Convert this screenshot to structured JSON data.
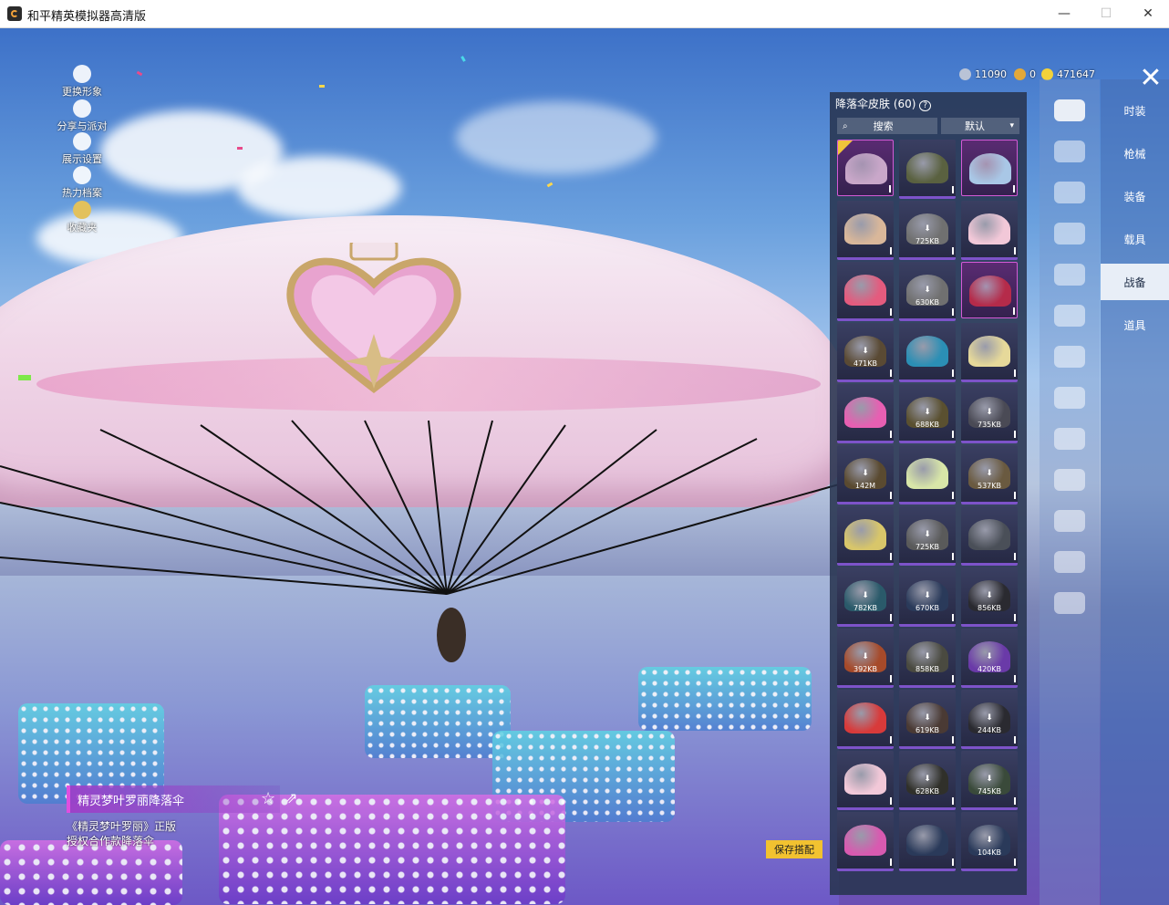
{
  "window": {
    "title": "和平精英模拟器高清版",
    "minimize": "—",
    "maximize": "☐",
    "close": "✕"
  },
  "left_menu": [
    {
      "label": "更换形象",
      "icon": "avatar-icon"
    },
    {
      "label": "分享与派对",
      "icon": "share-icon"
    },
    {
      "label": "展示设置",
      "icon": "eye-icon"
    },
    {
      "label": "热力档案",
      "icon": "fire-icon"
    },
    {
      "label": "收藏夹",
      "icon": "badge-icon"
    }
  ],
  "currency": {
    "a": "11090",
    "b": "0",
    "c": "471647"
  },
  "panel": {
    "title": "降落伞皮肤 (60)",
    "help": "?",
    "search_label": "搜索",
    "sort_label": "默认",
    "items": [
      {
        "color": "#c9a7c9",
        "size": "",
        "selected": true,
        "pink": true
      },
      {
        "color": "#5a6140",
        "size": "",
        "selected": false,
        "pink": false
      },
      {
        "color": "#a9c7e6",
        "size": "",
        "selected": false,
        "pink": true
      },
      {
        "color": "#d9b79a",
        "size": "",
        "selected": false,
        "pink": false
      },
      {
        "color": "#707070",
        "size": "725KB",
        "selected": false,
        "pink": false
      },
      {
        "color": "#f2c8d8",
        "size": "",
        "selected": false,
        "pink": false
      },
      {
        "color": "#e45b7e",
        "size": "",
        "selected": false,
        "pink": false
      },
      {
        "color": "#707070",
        "size": "630KB",
        "selected": false,
        "pink": false
      },
      {
        "color": "#b52b4a",
        "size": "",
        "selected": false,
        "pink": true
      },
      {
        "color": "#5a4a34",
        "size": "471KB",
        "selected": false,
        "pink": false
      },
      {
        "color": "#2b8fb5",
        "size": "",
        "selected": false,
        "pink": false
      },
      {
        "color": "#e6d99a",
        "size": "",
        "selected": false,
        "pink": false
      },
      {
        "color": "#e75fb2",
        "size": "",
        "selected": false,
        "pink": false
      },
      {
        "color": "#5a5030",
        "size": "688KB",
        "selected": false,
        "pink": false
      },
      {
        "color": "#4a4a55",
        "size": "735KB",
        "selected": false,
        "pink": false
      },
      {
        "color": "#5a4a30",
        "size": "142M",
        "selected": false,
        "pink": false
      },
      {
        "color": "#d8e6a8",
        "size": "",
        "selected": false,
        "pink": false
      },
      {
        "color": "#6a5a40",
        "size": "537KB",
        "selected": false,
        "pink": false
      },
      {
        "color": "#d8c66a",
        "size": "",
        "selected": false,
        "pink": false
      },
      {
        "color": "#5a5a5a",
        "size": "725KB",
        "selected": false,
        "pink": false
      },
      {
        "color": "#4a4f58",
        "size": "",
        "selected": false,
        "pink": false
      },
      {
        "color": "#2a5a6a",
        "size": "782KB",
        "selected": false,
        "pink": false
      },
      {
        "color": "#2a3a5a",
        "size": "670KB",
        "selected": false,
        "pink": false
      },
      {
        "color": "#2a2a30",
        "size": "856KB",
        "selected": false,
        "pink": false
      },
      {
        "color": "#a64a2a",
        "size": "392KB",
        "selected": false,
        "pink": false
      },
      {
        "color": "#4a4a40",
        "size": "858KB",
        "selected": false,
        "pink": false
      },
      {
        "color": "#6a3aa8",
        "size": "420KB",
        "selected": false,
        "pink": false
      },
      {
        "color": "#d83a3a",
        "size": "",
        "selected": false,
        "pink": false
      },
      {
        "color": "#4a3a34",
        "size": "619KB",
        "selected": false,
        "pink": false
      },
      {
        "color": "#2a2a30",
        "size": "244KB",
        "selected": false,
        "pink": false
      },
      {
        "color": "#f2c8d8",
        "size": "",
        "selected": false,
        "pink": false
      },
      {
        "color": "#30302a",
        "size": "628KB",
        "selected": false,
        "pink": false
      },
      {
        "color": "#3a4a3a",
        "size": "745KB",
        "selected": false,
        "pink": false
      },
      {
        "color": "#d85ab0",
        "size": "",
        "selected": false,
        "pink": false
      },
      {
        "color": "#2a3a5a",
        "size": "",
        "selected": false,
        "pink": false
      },
      {
        "color": "#2a3a5a",
        "size": "104KB",
        "selected": false,
        "pink": false
      }
    ]
  },
  "icon_tabs": [
    {
      "icon": "parachute-icon",
      "active": true
    },
    {
      "icon": "boat-icon",
      "active": false
    },
    {
      "icon": "drone-icon",
      "active": false
    },
    {
      "icon": "plane-icon",
      "active": false
    },
    {
      "icon": "emote-icon",
      "active": false
    },
    {
      "icon": "robot-icon",
      "active": false
    },
    {
      "icon": "sound-icon",
      "active": false
    },
    {
      "icon": "chat-icon",
      "active": false
    },
    {
      "icon": "picture-icon",
      "active": false
    },
    {
      "icon": "extinguisher-icon",
      "active": false
    },
    {
      "icon": "hand-icon",
      "active": false
    },
    {
      "icon": "sparkle-icon",
      "active": false
    },
    {
      "icon": "hat-icon",
      "active": false
    }
  ],
  "categories": [
    {
      "label": "时装",
      "active": false
    },
    {
      "label": "枪械",
      "active": false
    },
    {
      "label": "装备",
      "active": false
    },
    {
      "label": "载具",
      "active": false
    },
    {
      "label": "战备",
      "active": true
    },
    {
      "label": "道具",
      "active": false
    }
  ],
  "item": {
    "name": "精灵梦叶罗丽降落伞",
    "desc_line1": "《精灵梦叶罗丽》正版",
    "desc_line2": "授权合作款降落伞"
  },
  "save_label": "保存搭配",
  "colors": {
    "accent_yellow": "#f2c230",
    "accent_pink": "#e04ee0"
  }
}
